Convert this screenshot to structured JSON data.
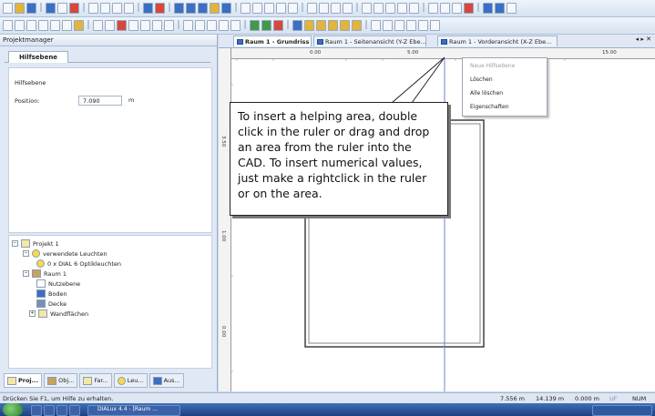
{
  "panel": {
    "title": "Projektmanager",
    "tab": "Hilfsebene",
    "group_label": "Hilfsebene",
    "position_label": "Position:",
    "position_value": "7.090",
    "position_unit": "m"
  },
  "tree": {
    "project": "Projekt 1",
    "used_luminaires": "verwendete Leuchten",
    "luminaire_item": "0 x DIAL 6 Optikleuchten",
    "room": "Raum 1",
    "useful_plane": "Nutzebene",
    "floor": "Boden",
    "ceiling": "Decke",
    "walls": "Wandflächen"
  },
  "bottom_tabs": [
    "Proj...",
    "Obj...",
    "Far...",
    "Leu...",
    "Aus..."
  ],
  "doc_tabs": [
    "Raum 1 - Grundriss",
    "Raum 1 - Seitenansicht (Y-Z Ebe...",
    "Raum 1 - Vorderansicht (X-Z Ebe..."
  ],
  "doc_nav": "◂ ▸ ✕",
  "ruler": {
    "h_labels": [
      "0.00",
      "5.00",
      "15.00"
    ],
    "v_labels": [
      "3.50",
      "1.00",
      "0.00"
    ],
    "corner": "m"
  },
  "context_menu": {
    "items": [
      "Neue Hilfsebene",
      "Löschen",
      "Alle löschen",
      "Eigenschaften"
    ]
  },
  "callout_text": "To insert a helping area, double click in the ruler or drag and drop an area from the ruler into the CAD. To insert numerical values, just make a rightclick in the ruler or on the area.",
  "status": {
    "help": "Drücken Sie F1, um Hilfe zu erhalten.",
    "x": "7.556 m",
    "y": "14.139 m",
    "z": "0.000 m",
    "uf": "UF",
    "num": "NUM"
  },
  "taskbar": {
    "app_button": "DIALux 4.4 - [Raum ..."
  }
}
